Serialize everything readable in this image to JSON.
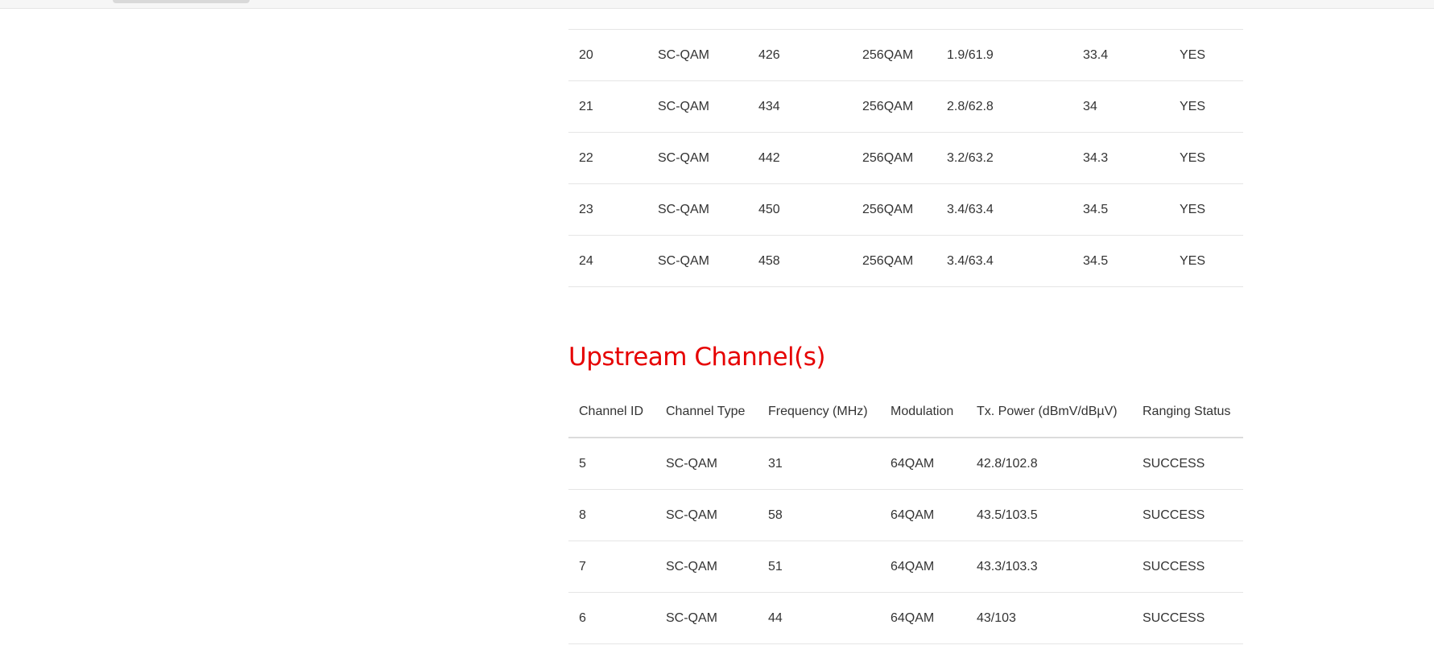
{
  "downstream": {
    "rows": [
      {
        "id": "20",
        "type": "SC-QAM",
        "freq": "426",
        "mod": "256QAM",
        "power": "1.9/61.9",
        "snr": "33.4",
        "locked": "YES"
      },
      {
        "id": "21",
        "type": "SC-QAM",
        "freq": "434",
        "mod": "256QAM",
        "power": "2.8/62.8",
        "snr": "34",
        "locked": "YES"
      },
      {
        "id": "22",
        "type": "SC-QAM",
        "freq": "442",
        "mod": "256QAM",
        "power": "3.2/63.2",
        "snr": "34.3",
        "locked": "YES"
      },
      {
        "id": "23",
        "type": "SC-QAM",
        "freq": "450",
        "mod": "256QAM",
        "power": "3.4/63.4",
        "snr": "34.5",
        "locked": "YES"
      },
      {
        "id": "24",
        "type": "SC-QAM",
        "freq": "458",
        "mod": "256QAM",
        "power": "3.4/63.4",
        "snr": "34.5",
        "locked": "YES"
      }
    ]
  },
  "upstream": {
    "title": "Upstream Channel(s)",
    "headers": {
      "id": "Channel ID",
      "type": "Channel Type",
      "freq": "Frequency (MHz)",
      "mod": "Modulation",
      "power": "Tx. Power (dBmV/dBµV)",
      "status": "Ranging Status"
    },
    "rows": [
      {
        "id": "5",
        "type": "SC-QAM",
        "freq": "31",
        "mod": "64QAM",
        "power": "42.8/102.8",
        "status": "SUCCESS"
      },
      {
        "id": "8",
        "type": "SC-QAM",
        "freq": "58",
        "mod": "64QAM",
        "power": "43.5/103.5",
        "status": "SUCCESS"
      },
      {
        "id": "7",
        "type": "SC-QAM",
        "freq": "51",
        "mod": "64QAM",
        "power": "43.3/103.3",
        "status": "SUCCESS"
      },
      {
        "id": "6",
        "type": "SC-QAM",
        "freq": "44",
        "mod": "64QAM",
        "power": "43/103",
        "status": "SUCCESS"
      }
    ]
  },
  "colors": {
    "accent": "#e60000",
    "text": "#333333",
    "divider": "#e5e5e5"
  }
}
